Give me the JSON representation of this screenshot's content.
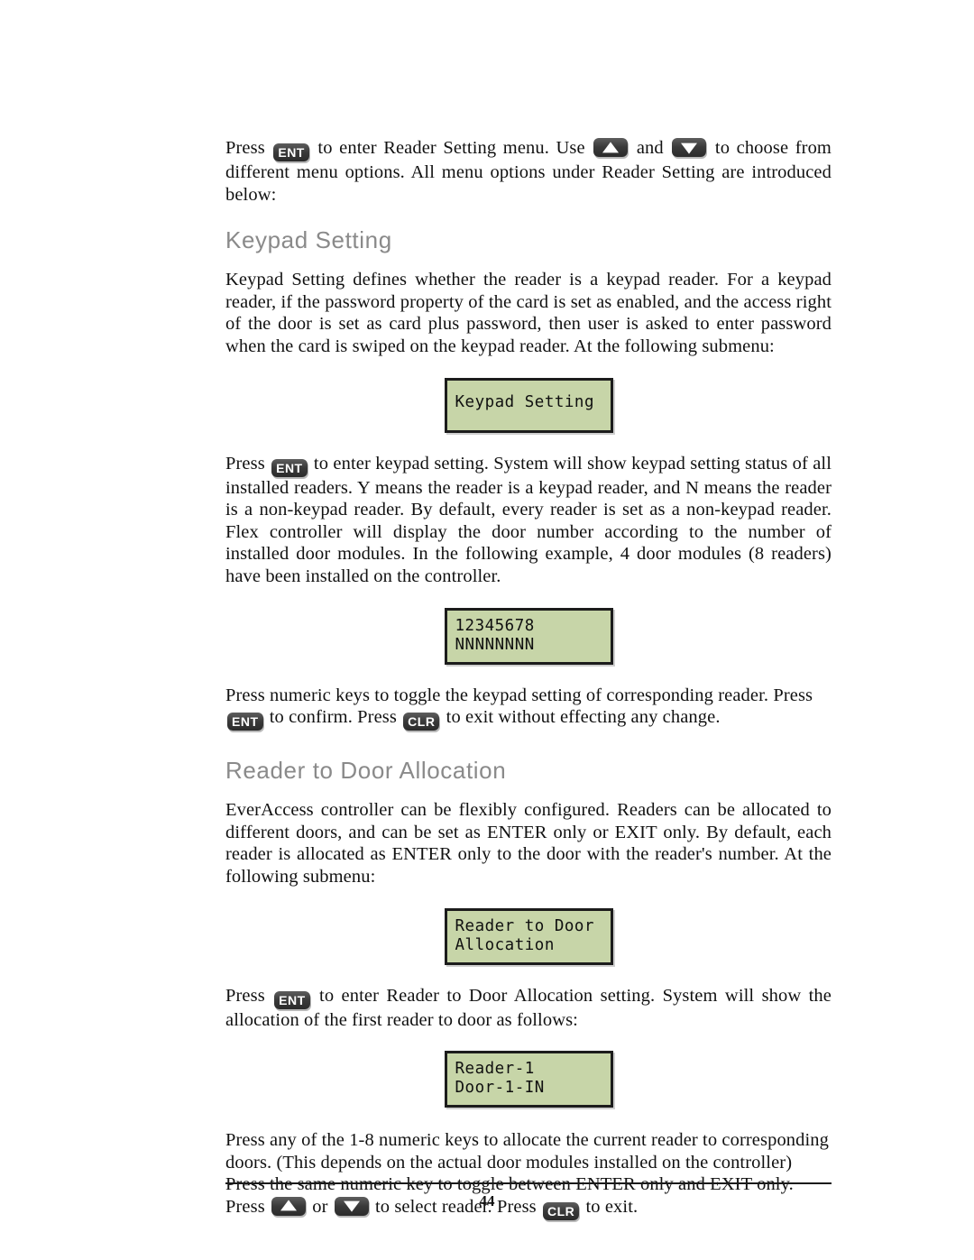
{
  "document": {
    "page_number": "44"
  },
  "keys": {
    "ent": "ENT",
    "clr": "CLR",
    "up": "up-arrow",
    "down": "down-arrow"
  },
  "intro": {
    "part1": "Press ",
    "part2": " to enter Reader Setting menu. Use ",
    "part3": " and ",
    "part4": " to choose from different menu options. All menu options under Reader Setting are introduced below:"
  },
  "keypad_setting": {
    "heading": "Keypad Setting",
    "paragraph1": "Keypad Setting defines whether the reader is a keypad reader. For a keypad reader, if the password property of the card is set as enabled, and the access right of the door is set as card plus password, then user is asked to enter password when the card is swiped on the keypad reader.  At the following submenu:",
    "lcd1": {
      "line1": "Keypad Setting"
    },
    "paragraph2": {
      "part1": "Press ",
      "part2": " to enter keypad setting. System will show keypad setting status of all installed readers. Y means the reader is a keypad reader, and N means the reader is a non-keypad reader. By default, every reader is set as a non-keypad reader. Flex controller will display the door number according to the number of installed door modules. In the following example, 4 door modules (8 readers) have been installed on the controller."
    },
    "lcd2": {
      "line1": "12345678",
      "line2": "NNNNNNNN"
    },
    "paragraph3": {
      "part1": "Press numeric keys to toggle the keypad setting of corresponding reader. Press ",
      "part2": " to confirm. Press ",
      "part3": " to exit without effecting any change."
    }
  },
  "reader_to_door": {
    "heading": "Reader to Door Allocation",
    "paragraph1": "EverAccess controller can be flexibly configured. Readers can be allocated to different doors, and can be set as ENTER only or EXIT only. By default, each reader is allocated as ENTER only to the door with the reader's number. At the following submenu:",
    "lcd1": {
      "line1": "Reader to Door",
      "line2": "Allocation"
    },
    "paragraph2": {
      "part1": "Press ",
      "part2": " to enter Reader to Door Allocation setting. System will show the allocation of the first reader to door as follows:"
    },
    "lcd2": {
      "line1": "Reader-1",
      "line2": "Door-1-IN"
    },
    "paragraph3": {
      "part1": "Press any of the 1-8 numeric keys to allocate the current reader to corresponding doors. (This depends on the actual door modules installed on the controller) Press the same numeric key to toggle between ENTER only and EXIT only. Press ",
      "part2": " or ",
      "part3": " to select reader. Press ",
      "part4": " to exit."
    }
  },
  "colors": {
    "lcd_background": "#c7d5a8",
    "lcd_border": "#1c1c1c",
    "heading_gray": "#8a8a8a",
    "keycap_dark": "#3a3a3a"
  }
}
